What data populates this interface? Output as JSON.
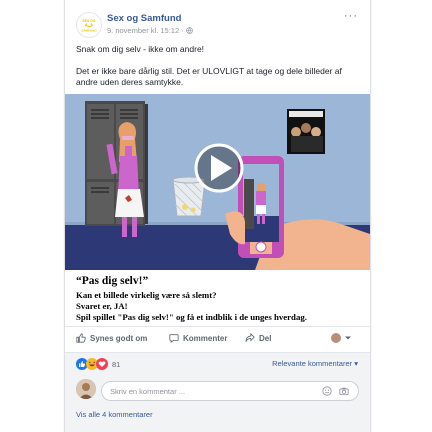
{
  "post": {
    "page_name": "Sex og Samfund",
    "date": "9. november kl. 15:12",
    "privacy_icon": "globe-icon",
    "logo_text": "SEX OG SAMFUND",
    "more_label": "···",
    "text_line1": "Snak om dig selv - ikke om andre!",
    "text_line2": "Det er ikke bare dårlig stil. Det er ULOVLIGT at tage og dele billeder af andre uden deres samtykke."
  },
  "media": {
    "type": "video",
    "play_icon": "play-icon"
  },
  "caption": {
    "title": "“Pas dig selv!”",
    "line1": "Kan et billede virkelig være så slemt?",
    "line2": "Svaret er, JA!",
    "line3": "Spil spillet \"Pas dig selv!\" og få et indblik i de unges hverdag."
  },
  "actions": {
    "like": "Synes godt om",
    "comment": "Kommenter",
    "share": "Del"
  },
  "reactions": {
    "count": "81",
    "sort_label": "Relevante kommentarer ▾",
    "colors": {
      "like": "#1877f2",
      "haha": "#f7b928",
      "love": "#f33e58"
    }
  },
  "comments": {
    "placeholder": "Skriv en kommentar ...",
    "view_all": "Vis alle 4 kommentarer"
  }
}
